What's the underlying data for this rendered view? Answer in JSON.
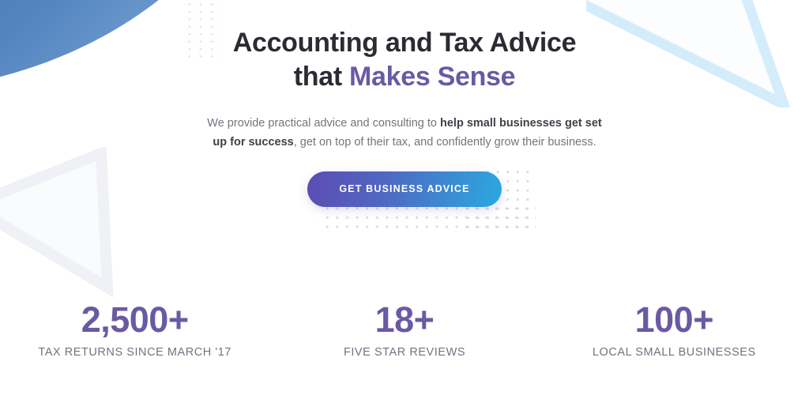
{
  "hero": {
    "headline_line1": "Accounting and Tax Advice",
    "headline_line2_prefix": "that ",
    "headline_line2_accent": "Makes Sense",
    "subhead_part1": "We provide practical advice and consulting to ",
    "subhead_bold1": "help small businesses get set up for success",
    "subhead_part2": ", get on top of their tax, and confidently grow their business.",
    "cta_label": "GET BUSINESS ADVICE"
  },
  "stats": [
    {
      "value": "2,500+",
      "label": "TAX RETURNS SINCE MARCH '17"
    },
    {
      "value": "18+",
      "label": "FIVE STAR REVIEWS"
    },
    {
      "value": "100+",
      "label": "LOCAL SMALL BUSINESSES"
    }
  ],
  "decorations": {
    "swoosh_top_left": "blue-swoosh-shape",
    "triangle_top_right": "pale-blue-triangle-outline",
    "triangle_left": "light-gray-triangle-outline",
    "dot_grid_blue": "blue-dot-grid",
    "dot_grid_gray": "gray-dot-grid"
  },
  "colors": {
    "accent_purple": "#6a5aa4",
    "heading_dark": "#2b2b33",
    "body_gray": "#72757c",
    "label_gray": "#6e7580",
    "cta_gradient_start": "#5d4cb2",
    "cta_gradient_end": "#2aa9e0",
    "swoosh_blue": "#4d7fbb",
    "triangle_blue": "#d7eefa",
    "triangle_gray": "#f1f2f6",
    "dot_blue": "#cfeaf9",
    "dot_gray": "#d7d9e2"
  }
}
